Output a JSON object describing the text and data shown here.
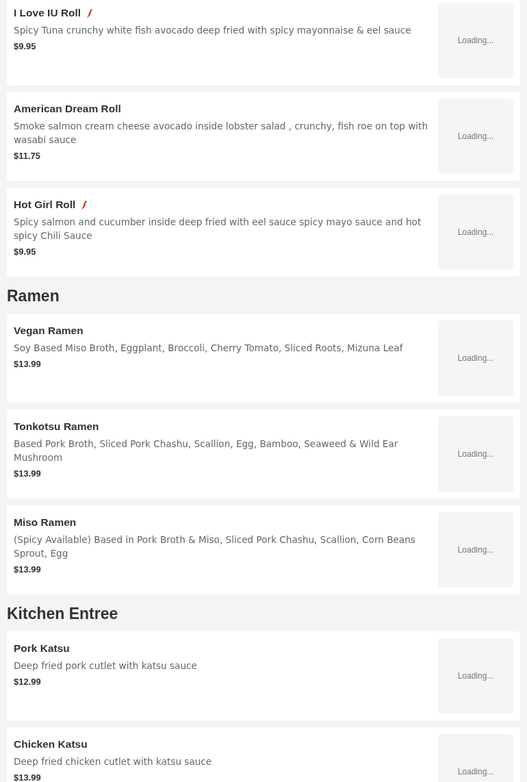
{
  "sections": [
    {
      "items": [
        {
          "name": "I Love IU Roll",
          "spicy": true,
          "description": "Spicy Tuna crunchy white fish avocado deep fried with spicy mayonnaise & eel sauce",
          "price": "$9.95",
          "image_status": "Loading..."
        },
        {
          "name": "American Dream Roll",
          "spicy": false,
          "description": "Smoke salmon cream cheese avocado inside lobster salad , crunchy, fish roe on top with wasabi sauce",
          "price": "$11.75",
          "image_status": "Loading..."
        },
        {
          "name": "Hot Girl Roll",
          "spicy": true,
          "description": "Spicy salmon and cucumber inside deep fried with eel sauce spicy mayo sauce and hot spicy Chili Sauce",
          "price": "$9.95",
          "image_status": "Loading..."
        }
      ]
    },
    {
      "title": "Ramen",
      "items": [
        {
          "name": "Vegan Ramen",
          "spicy": false,
          "description": "Soy Based Miso Broth, Eggplant, Broccoli, Cherry Tomato, Sliced Roots, Mizuna Leaf",
          "price": "$13.99",
          "image_status": "Loading..."
        },
        {
          "name": "Tonkotsu Ramen",
          "spicy": false,
          "description": "Based Pork Broth, Sliced Pork Chashu, Scallion, Egg, Bamboo, Seaweed & Wild Ear Mushroom",
          "price": "$13.99",
          "image_status": "Loading..."
        },
        {
          "name": "Miso Ramen",
          "spicy": false,
          "description": "(Spicy Available) Based in Pork Broth & Miso, Sliced Pork Chashu, Scallion, Corn Beans Sprout, Egg",
          "price": "$13.99",
          "image_status": "Loading..."
        }
      ]
    },
    {
      "title": "Kitchen Entree",
      "items": [
        {
          "name": "Pork Katsu",
          "spicy": false,
          "description": "Deep fried pork cutlet with katsu sauce",
          "price": "$12.99",
          "image_status": "Loading..."
        },
        {
          "name": "Chicken Katsu",
          "spicy": false,
          "description": "Deep fried chicken cutlet with katsu sauce",
          "price": "$13.99",
          "image_status": "Loading..."
        }
      ]
    }
  ]
}
